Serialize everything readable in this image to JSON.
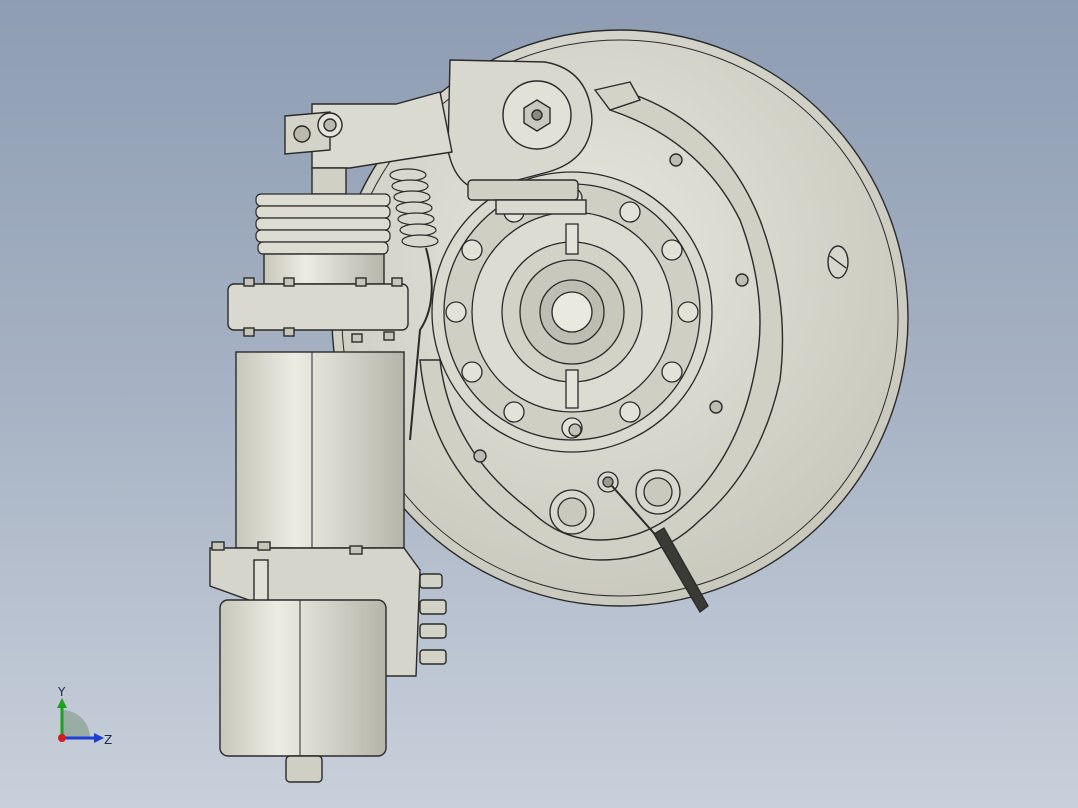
{
  "viewport": {
    "background_top": "#8e9db3",
    "background_bottom": "#c9d0db"
  },
  "model": {
    "line_color": "#2a2a2a",
    "fill_color": "#d6d6cc",
    "shadow_color": "#b9b9ae"
  },
  "triad": {
    "y_label": "Y",
    "z_label": "Z",
    "y_color": "#1aa31a",
    "z_color": "#1c3ed6",
    "x_color": "#d21e1e"
  }
}
